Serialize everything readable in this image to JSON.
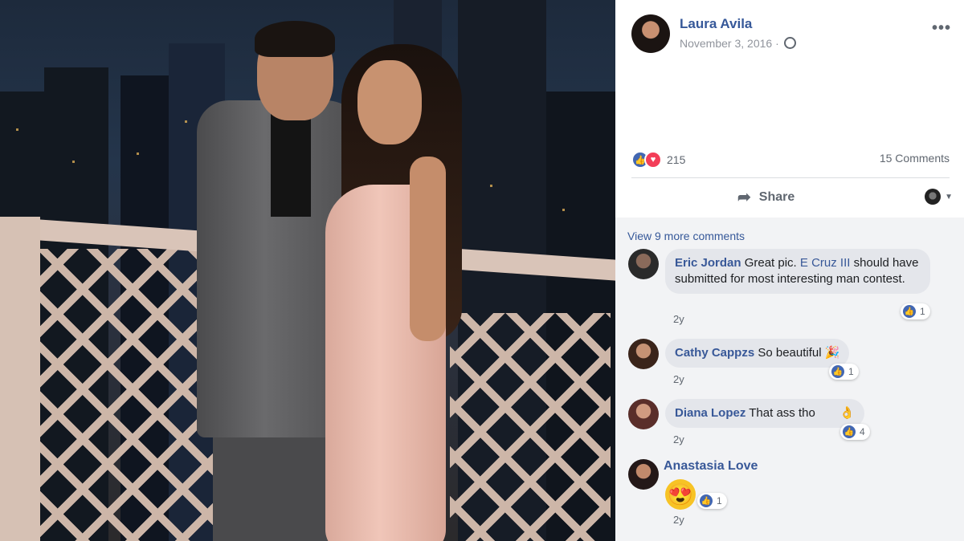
{
  "post": {
    "author": "Laura Avila",
    "date": "November 3, 2016 ·",
    "privacy_icon": "globe-icon",
    "more_icon": "•••"
  },
  "stats": {
    "reaction_count": "215",
    "comments_label": "15 Comments"
  },
  "actions": {
    "share_label": "Share"
  },
  "comments_section": {
    "view_more": "View 9 more comments",
    "items": [
      {
        "name": "Eric Jordan",
        "text_before": "Great pic.",
        "mention": "E Cruz III",
        "text_after": "should have submitted for most interesting man contest.",
        "age": "2y",
        "reactions": "1"
      },
      {
        "name": "Cathy Cappzs",
        "text": "So beautiful 🎉",
        "age": "2y",
        "reactions": "1"
      },
      {
        "name": "Diana Lopez",
        "text": "That ass tho",
        "emoji": "👌",
        "age": "2y",
        "reactions": "4"
      },
      {
        "name": "Anastasia Love",
        "emoji": "😍",
        "age": "2y",
        "reactions": "1"
      }
    ]
  },
  "colors": {
    "link": "#365899",
    "like": "#4267b2",
    "love": "#f33e58",
    "bubble": "#e4e6eb"
  }
}
